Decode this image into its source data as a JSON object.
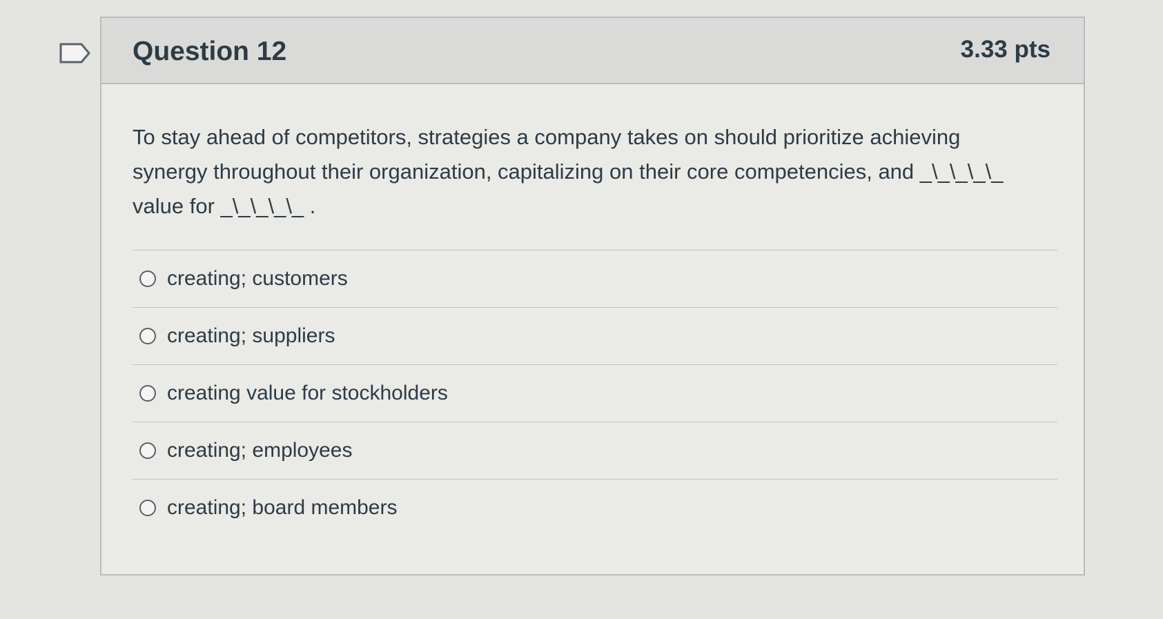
{
  "question": {
    "title": "Question 12",
    "points": "3.33 pts",
    "text": "To stay ahead of competitors, strategies a company takes on should prioritize achieving synergy throughout their organization, capitalizing on their core competencies, and _\\_\\_\\_\\_ value for _\\_\\_\\_\\_ .",
    "flag_icon": "flag-icon"
  },
  "answers": [
    {
      "label": "creating; customers",
      "selected": false
    },
    {
      "label": "creating; suppliers",
      "selected": false
    },
    {
      "label": "creating value for stockholders",
      "selected": false
    },
    {
      "label": "creating; employees",
      "selected": false
    },
    {
      "label": "creating; board members",
      "selected": false
    }
  ],
  "colors": {
    "page_background": "#e4e4e1",
    "header_background": "#dadbd9",
    "text": "#2d3b45",
    "border": "#b9bbbd"
  }
}
